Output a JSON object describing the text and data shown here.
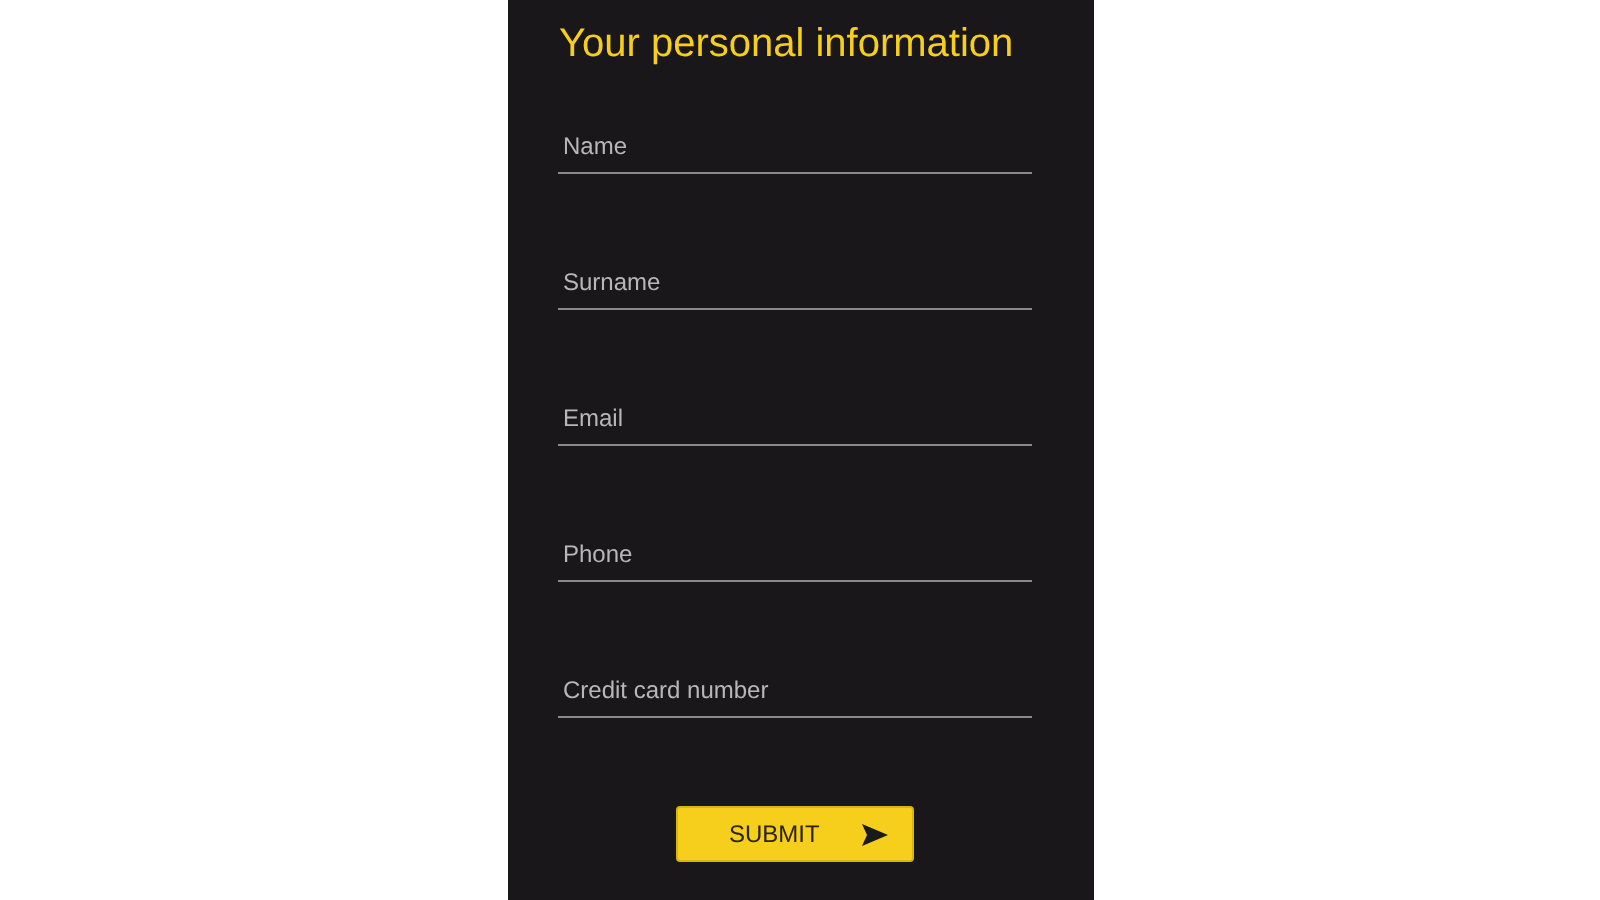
{
  "title": "Your personal information",
  "fields": [
    {
      "placeholder": "Name"
    },
    {
      "placeholder": "Surname"
    },
    {
      "placeholder": "Email"
    },
    {
      "placeholder": "Phone"
    },
    {
      "placeholder": "Credit card number"
    }
  ],
  "submit_button": {
    "label": "SUBMIT"
  }
}
